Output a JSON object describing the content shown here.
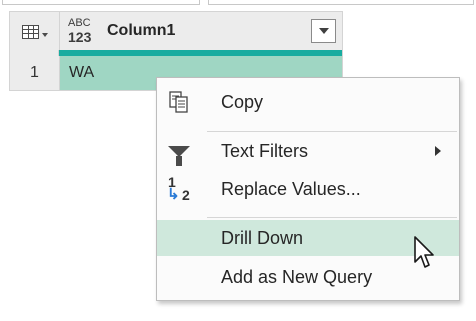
{
  "grid": {
    "column_type_abc": "ABC",
    "column_type_num": "123",
    "column_name": "Column1",
    "rows": [
      {
        "number": "1",
        "value": "WA"
      }
    ]
  },
  "context_menu": {
    "items": [
      {
        "label": "Copy",
        "icon": "copy-icon"
      },
      {
        "label": "Text Filters",
        "icon": "filter-icon",
        "has_submenu": true
      },
      {
        "label": "Replace Values...",
        "icon": "replace-values-icon",
        "icon_text_from": "1",
        "icon_text_to": "2"
      },
      {
        "label": "Drill Down",
        "highlighted": true
      },
      {
        "label": "Add as New Query"
      }
    ]
  },
  "colors": {
    "accent_bar": "#18aca0",
    "selected_cell": "#9fd6c3",
    "menu_highlight": "#cfe8dc"
  }
}
